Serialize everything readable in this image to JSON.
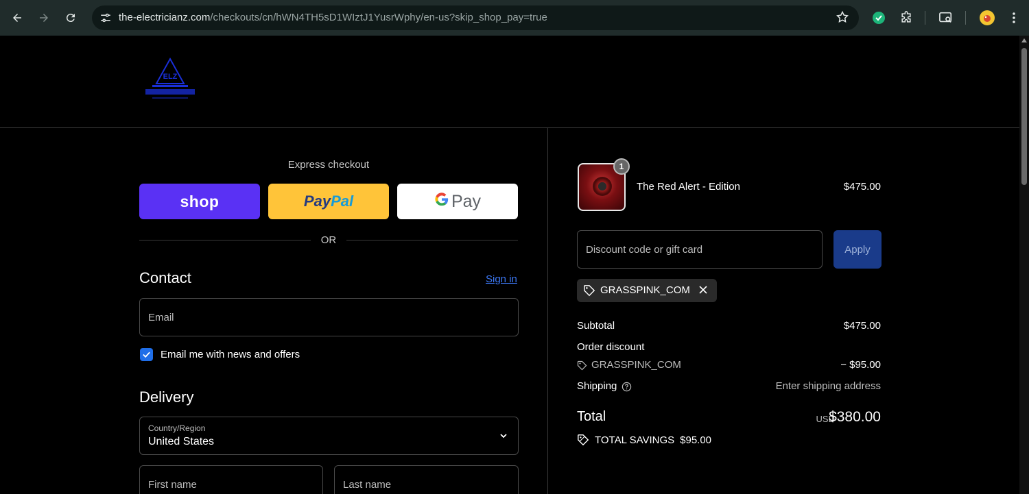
{
  "browser": {
    "url_main": "the-electricianz.com",
    "url_path": "/checkouts/cn/hWN4TH5sD1WIztJ1YusrWphy/en-us?skip_shop_pay=true"
  },
  "header": {
    "logo_text": "ELZ"
  },
  "express": {
    "title": "Express checkout",
    "shop_label": "shop",
    "paypal_label_1": "Pay",
    "paypal_label_2": "Pal",
    "gpay_g": "G",
    "gpay_label": "Pay",
    "or_label": "OR"
  },
  "contact": {
    "title": "Contact",
    "sign_in": "Sign in",
    "email_placeholder": "Email",
    "newsletter_label": "Email me with news and offers"
  },
  "delivery": {
    "title": "Delivery",
    "country_label": "Country/Region",
    "country_value": "United States",
    "first_name_placeholder": "First name",
    "last_name_placeholder": "Last name"
  },
  "order": {
    "item_name": "The Red Alert - Edition",
    "item_qty": "1",
    "item_price": "$475.00",
    "discount_placeholder": "Discount code or gift card",
    "apply_label": "Apply",
    "applied_code": "GRASSPINK_COM",
    "subtotal_label": "Subtotal",
    "subtotal_value": "$475.00",
    "order_discount_label": "Order discount",
    "discount_code": "GRASSPINK_COM",
    "discount_value": "− $95.00",
    "shipping_label": "Shipping",
    "shipping_value": "Enter shipping address",
    "total_label": "Total",
    "total_currency": "USD",
    "total_value": "$380.00",
    "savings_label": "TOTAL SAVINGS",
    "savings_value": "$95.00"
  },
  "colors": {
    "shop_purple": "#5a31f4",
    "paypal_yellow": "#ffc439",
    "link_blue": "#3c78f5",
    "apply_blue": "#1a3b8a"
  }
}
